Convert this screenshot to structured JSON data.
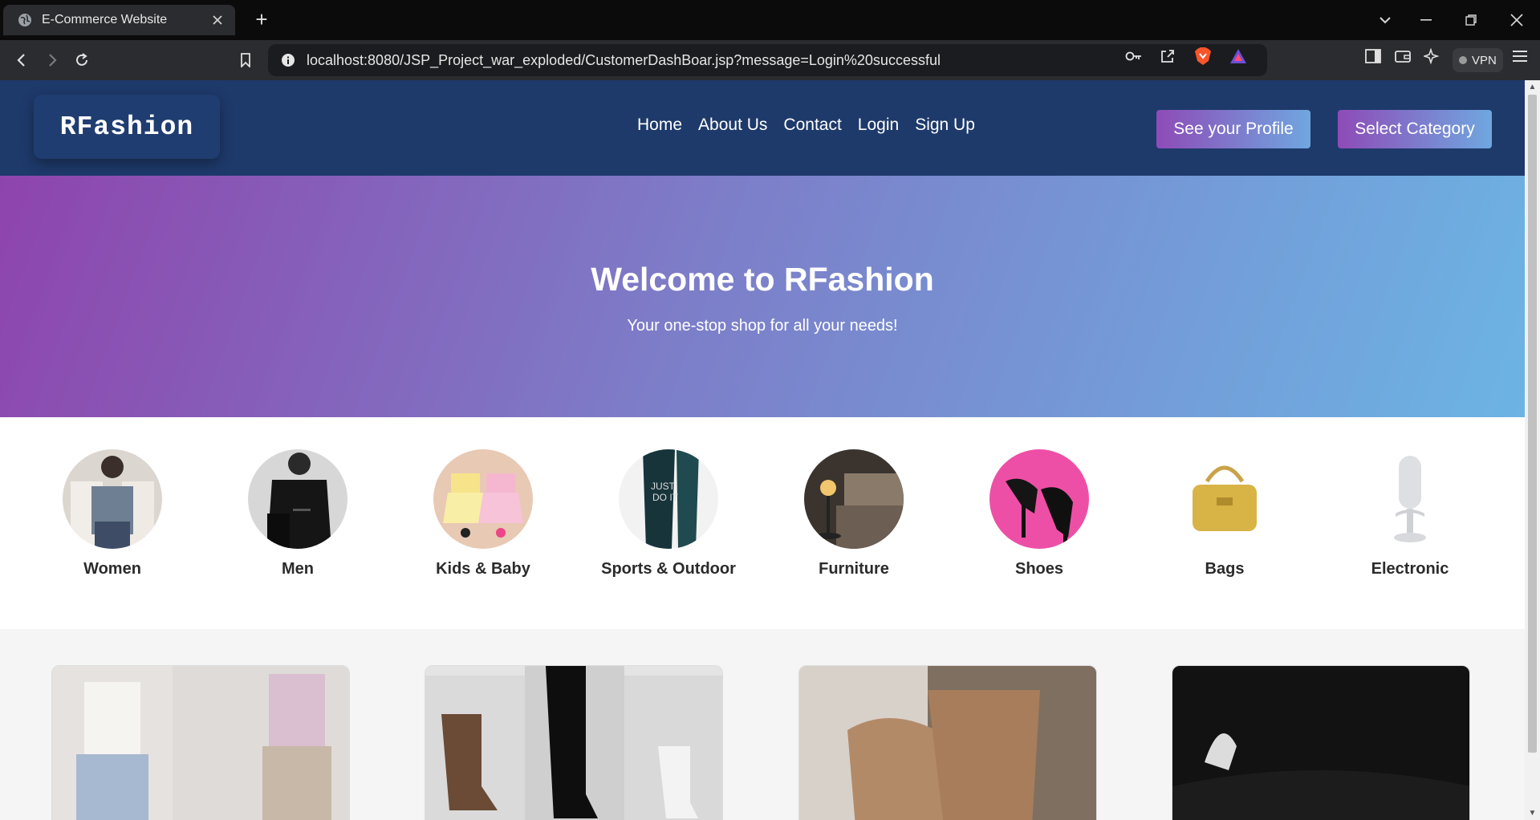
{
  "browser": {
    "tab_title": "E-Commerce Website",
    "new_tab_symbol": "+",
    "url": "localhost:8080/JSP_Project_war_exploded/CustomerDashBoar.jsp?message=Login%20successful",
    "vpn_label": "VPN"
  },
  "header": {
    "logo": "RFashion",
    "nav": [
      "Home",
      "About Us",
      "Contact",
      "Login",
      "Sign Up"
    ],
    "profile_button": "See your Profile",
    "category_button": "Select Category"
  },
  "hero": {
    "title": "Welcome to RFashion",
    "subtitle": "Your one-stop shop for all your needs!"
  },
  "categories": [
    {
      "label": "Women"
    },
    {
      "label": "Men"
    },
    {
      "label": "Kids & Baby"
    },
    {
      "label": "Sports & Outdoor"
    },
    {
      "label": "Furniture"
    },
    {
      "label": "Shoes"
    },
    {
      "label": "Bags"
    },
    {
      "label": "Electronic"
    }
  ],
  "colors": {
    "header_bg": "#1e3a6b",
    "hero_gradient_start": "#8e44ad",
    "hero_gradient_end": "#6cb4e4",
    "button_gradient_start": "#8e4bb7",
    "button_gradient_end": "#6fa7e0"
  },
  "icons": {
    "tab_favicon": "globe-icon",
    "tab_close": "close-icon",
    "back": "back-arrow-icon",
    "forward": "forward-arrow-icon",
    "reload": "reload-icon",
    "bookmark": "bookmark-icon",
    "site_info": "info-icon",
    "password": "key-icon",
    "share": "share-icon",
    "brave": "brave-shield-icon",
    "rewards": "rewards-triangle-icon",
    "sidebar": "sidebar-icon",
    "wallet": "wallet-icon",
    "leo": "ai-sparkle-icon",
    "menu": "hamburger-menu-icon"
  }
}
